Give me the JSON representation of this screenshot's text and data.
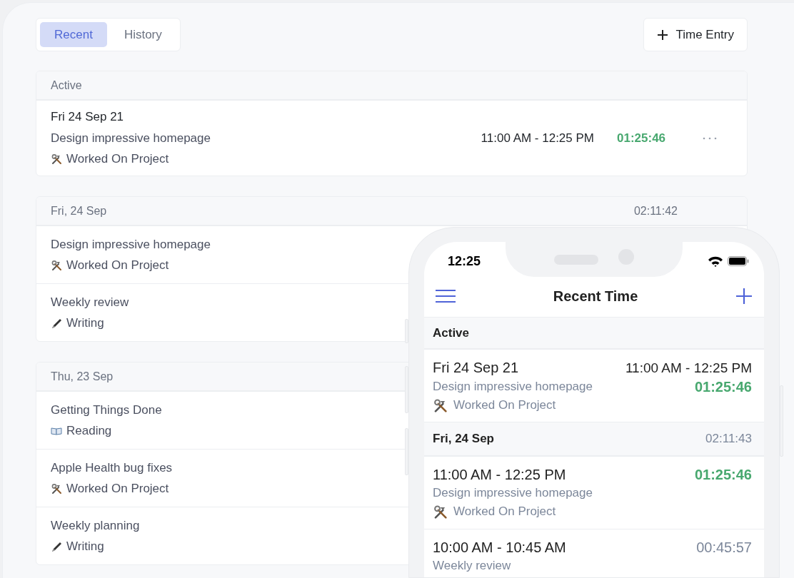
{
  "tabs": [
    {
      "label": "Recent",
      "selected": true
    },
    {
      "label": "History",
      "selected": false
    }
  ],
  "new_entry_button": {
    "label": "Time Entry"
  },
  "desktop_sections": [
    {
      "title": "Active",
      "entries": [
        {
          "date": "Fri 24 Sep 21",
          "title": "Design impressive homepage",
          "category": "Worked On Project",
          "kind": "tools",
          "time_range": "11:00 AM - 12:25 PM",
          "duration": "01:25:46",
          "running": true
        }
      ]
    },
    {
      "title": "Fri, 24 Sep",
      "total": "02:11:42",
      "entries": [
        {
          "title": "Design impressive homepage",
          "category": "Worked On Project",
          "kind": "tools"
        },
        {
          "title": "Weekly review",
          "category": "Writing",
          "kind": "pen"
        }
      ]
    },
    {
      "title": "Thu, 23 Sep",
      "entries": [
        {
          "title": "Getting Things Done",
          "category": "Reading",
          "kind": "book"
        },
        {
          "title": "Apple Health bug fixes",
          "category": "Worked On Project",
          "kind": "tools"
        },
        {
          "title": "Weekly planning",
          "category": "Writing",
          "kind": "pen"
        }
      ]
    }
  ],
  "phone": {
    "clock": "12:25",
    "title": "Recent Time",
    "sections": [
      {
        "title": "Active",
        "entries": [
          {
            "heading": "Fri 24 Sep 21",
            "time_range": "11:00 AM - 12:25 PM",
            "title": "Design impressive homepage",
            "category": "Worked On Project",
            "kind": "tools",
            "duration": "01:25:46",
            "running": true
          }
        ]
      },
      {
        "title": "Fri, 24 Sep",
        "total": "02:11:43",
        "entries": [
          {
            "heading": "11:00 AM - 12:25 PM",
            "title": "Design impressive homepage",
            "category": "Worked On Project",
            "kind": "tools",
            "duration": "01:25:46",
            "running": true
          },
          {
            "heading": "10:00 AM - 10:45 AM",
            "title": "Weekly review",
            "duration": "00:45:57",
            "running": false
          }
        ]
      }
    ]
  }
}
